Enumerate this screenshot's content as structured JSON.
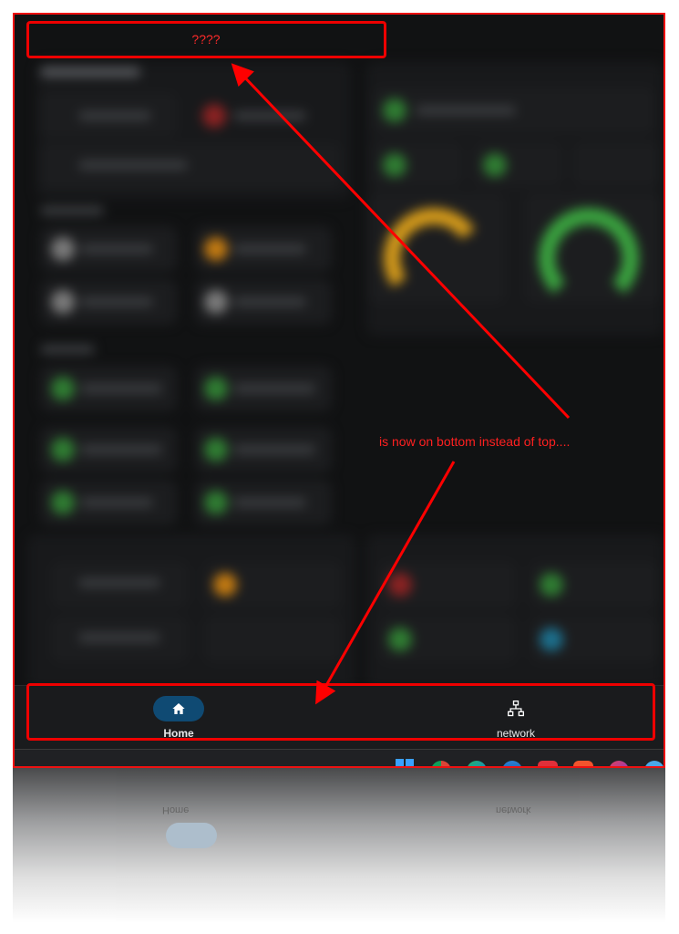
{
  "annotation": {
    "top_box_text": "????",
    "note": "is now on bottom instead of top...."
  },
  "navbar": {
    "items": [
      {
        "label": "Home",
        "icon": "home-icon",
        "active": true
      },
      {
        "label": "network",
        "icon": "network-icon",
        "active": false
      }
    ]
  },
  "taskbar": {
    "icons": [
      "windows-start-icon",
      "chrome-icon",
      "edge-icon",
      "browser-icon",
      "vivaldi-icon",
      "brave-icon",
      "app-icon",
      "blue-app-icon"
    ]
  },
  "reflection": {
    "labels": [
      "Home",
      "network"
    ]
  },
  "colors": {
    "accent": "#0f4a73",
    "annotation_red": "#ff0000",
    "background": "#111213"
  }
}
